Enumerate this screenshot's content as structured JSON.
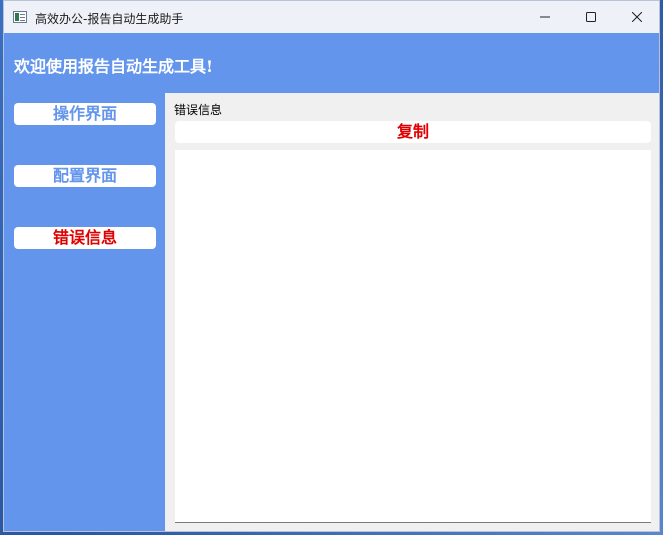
{
  "window": {
    "title": "高效办公-报告自动生成助手"
  },
  "header": {
    "title": "欢迎使用报告自动生成工具!"
  },
  "sidebar": {
    "items": [
      {
        "label": "操作界面",
        "active": false
      },
      {
        "label": "配置界面",
        "active": false
      },
      {
        "label": "错误信息",
        "active": true
      }
    ]
  },
  "main": {
    "section_label": "错误信息",
    "copy_label": "复制",
    "error_text": ""
  },
  "colors": {
    "accent": "#6495ed",
    "active_text": "#e00000",
    "background": "#f0f0f0"
  }
}
